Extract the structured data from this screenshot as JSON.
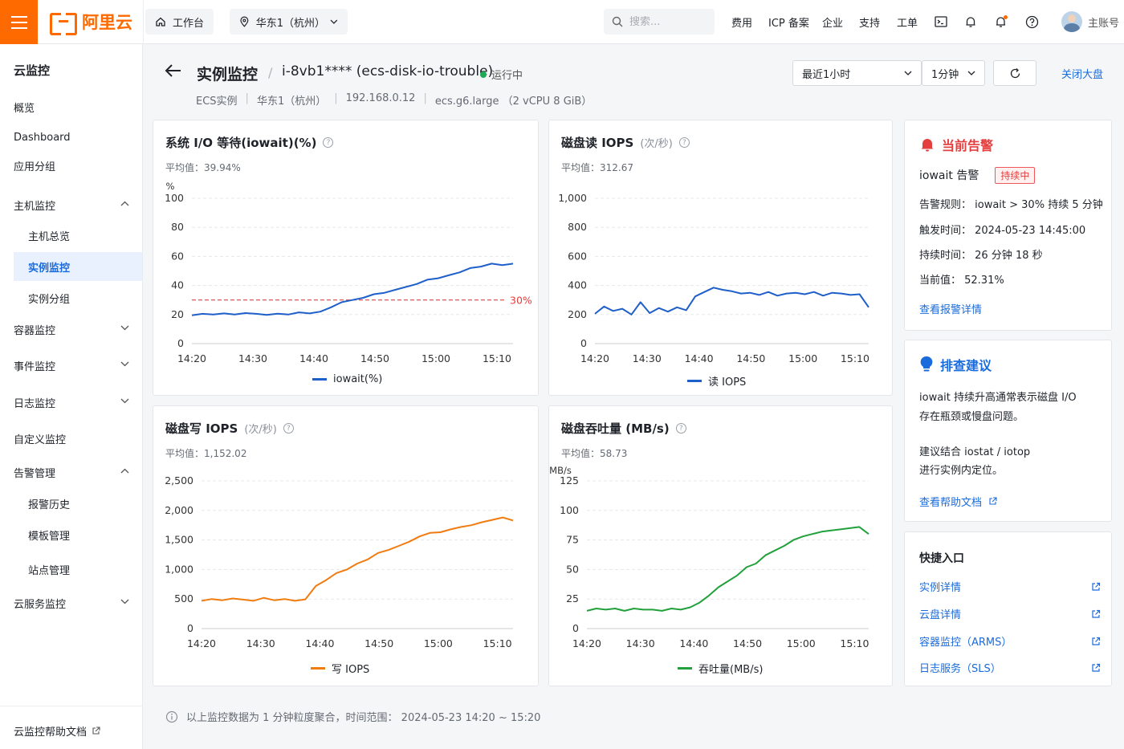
{
  "topbar": {
    "brand": "阿里云",
    "workbench": "工作台",
    "region": "华东1（杭州）",
    "search_placeholder": "搜索...",
    "nav": [
      "费用",
      "ICP 备案",
      "企业",
      "支持",
      "工单"
    ],
    "account": "主账号"
  },
  "sidebar": {
    "title": "云监控",
    "items": [
      {
        "label": "概览",
        "level": 0
      },
      {
        "label": "Dashboard",
        "level": 0
      },
      {
        "label": "应用分组",
        "level": 0
      },
      {
        "label": "主机监控",
        "level": 0,
        "expanded": true
      },
      {
        "label": "主机总览",
        "level": 1
      },
      {
        "label": "实例监控",
        "level": 1,
        "active": true
      },
      {
        "label": "实例分组",
        "level": 1
      },
      {
        "label": "容器监控",
        "level": 0,
        "expanded": false
      },
      {
        "label": "事件监控",
        "level": 0,
        "expanded": false
      },
      {
        "label": "日志监控",
        "level": 0,
        "expanded": false
      },
      {
        "label": "自定义监控",
        "level": 0
      },
      {
        "label": "告警管理",
        "level": 0,
        "expanded": true
      },
      {
        "label": "报警历史",
        "level": 1
      },
      {
        "label": "模板管理",
        "level": 1
      },
      {
        "label": "站点管理",
        "level": 1
      },
      {
        "label": "云服务监控",
        "level": 0,
        "expanded": false
      }
    ],
    "footer_link": "云监控帮助文档"
  },
  "header": {
    "title": "实例监控",
    "instance": "i-8vb1**** (ecs-disk-io-trouble)",
    "status": "运行中",
    "meta": [
      "ECS实例",
      "华东1（杭州）",
      "192.168.0.12",
      "ecs.g6.large （2 vCPU 8 GiB）"
    ],
    "time_range": "最近1小时",
    "interval": "1分钟",
    "close_dashboard": "关闭大盘"
  },
  "charts": {
    "iowait": {
      "title": "系统 I/O 等待(iowait)(%)",
      "unit": "",
      "avg_label": "平均值：",
      "avg_value": "39.94%",
      "legend": "iowait(%)",
      "threshold_label": "30%"
    },
    "read_iops": {
      "title": "磁盘读  IOPS",
      "unit": "(次/秒)",
      "avg_label": "平均值：",
      "avg_value": "312.67",
      "legend": "读 IOPS"
    },
    "write_iops": {
      "title": "磁盘写  IOPS",
      "unit": "(次/秒)",
      "avg_label": "平均值：",
      "avg_value": "1,152.02",
      "legend": "写 IOPS"
    },
    "throughput": {
      "title": "磁盘吞吐量 (MB/s)",
      "unit": "",
      "avg_label": "平均值：",
      "avg_value": "58.73",
      "legend": "吞吐量(MB/s)"
    }
  },
  "chart_data": [
    {
      "type": "line",
      "title": "系统 I/O 等待(iowait)(%)",
      "ylabel": "%",
      "ylim": [
        0,
        100
      ],
      "yticks": [
        0,
        20,
        40,
        60,
        80,
        100
      ],
      "xticks": [
        "14:20",
        "14:30",
        "14:40",
        "14:50",
        "15:00",
        "15:10"
      ],
      "threshold": 30,
      "color": "#1f5fc9",
      "series": [
        {
          "name": "iowait(%)",
          "x": [
            0,
            2,
            4,
            6,
            8,
            10,
            12,
            14,
            16,
            18,
            20,
            22,
            24,
            26,
            28,
            30,
            32,
            34,
            36,
            38,
            40,
            42,
            44,
            46,
            48,
            50,
            52,
            54,
            56,
            58,
            60
          ],
          "values": [
            19.5,
            20.5,
            20,
            20.8,
            20,
            21,
            20.5,
            19.8,
            20.6,
            20,
            21.5,
            20.8,
            22,
            25,
            28.5,
            30,
            31.5,
            34,
            35,
            37,
            39,
            41,
            44,
            45,
            47,
            49,
            52,
            53,
            55,
            54,
            55
          ]
        }
      ]
    },
    {
      "type": "line",
      "title": "磁盘读  IOPS",
      "ylim": [
        0,
        1000
      ],
      "yticks": [
        "0",
        "200",
        "400",
        "600",
        "800",
        "1,000"
      ],
      "xticks": [
        "14:20",
        "14:30",
        "14:40",
        "14:50",
        "15:00",
        "15:10"
      ],
      "color": "#1f5fc9",
      "series": [
        {
          "name": "读 IOPS",
          "x": [
            0,
            2,
            4,
            6,
            8,
            10,
            12,
            14,
            16,
            18,
            20,
            22,
            24,
            26,
            28,
            30,
            32,
            34,
            36,
            38,
            40,
            42,
            44,
            46,
            48,
            50,
            52,
            54,
            56,
            58,
            60
          ],
          "values": [
            205,
            255,
            225,
            240,
            200,
            285,
            210,
            245,
            220,
            250,
            230,
            325,
            355,
            385,
            370,
            360,
            345,
            350,
            335,
            355,
            330,
            345,
            350,
            340,
            355,
            330,
            350,
            345,
            335,
            340,
            250
          ]
        }
      ]
    },
    {
      "type": "line",
      "title": "磁盘写  IOPS",
      "ylim": [
        0,
        2500
      ],
      "yticks": [
        "0",
        "500",
        "1,000",
        "1,500",
        "2,000",
        "2,500"
      ],
      "xticks": [
        "14:20",
        "14:30",
        "14:40",
        "14:50",
        "15:00",
        "15:10"
      ],
      "color": "#f07c10",
      "series": [
        {
          "name": "写 IOPS",
          "x": [
            0,
            2,
            4,
            6,
            8,
            10,
            12,
            14,
            16,
            18,
            20,
            22,
            24,
            26,
            28,
            30,
            32,
            34,
            36,
            38,
            40,
            42,
            44,
            46,
            48,
            50,
            52,
            54,
            56,
            58,
            60
          ],
          "values": [
            470,
            500,
            480,
            510,
            490,
            470,
            520,
            480,
            500,
            470,
            495,
            720,
            820,
            940,
            1000,
            1100,
            1170,
            1280,
            1330,
            1400,
            1470,
            1560,
            1620,
            1630,
            1680,
            1720,
            1750,
            1800,
            1840,
            1880,
            1830
          ]
        }
      ]
    },
    {
      "type": "line",
      "title": "磁盘吞吐量 (MB/s)",
      "ylabel": "MB/s",
      "ylim": [
        0,
        125
      ],
      "yticks": [
        0,
        25,
        50,
        75,
        100,
        125
      ],
      "xticks": [
        "14:20",
        "14:30",
        "14:40",
        "14:50",
        "15:00",
        "15:10"
      ],
      "color": "#22a03c",
      "series": [
        {
          "name": "吞吐量(MB/s)",
          "x": [
            0,
            2,
            4,
            6,
            8,
            10,
            12,
            14,
            16,
            18,
            20,
            22,
            24,
            26,
            28,
            30,
            32,
            34,
            36,
            38,
            40,
            42,
            44,
            46,
            48,
            50,
            52,
            54,
            56,
            58,
            60
          ],
          "values": [
            15,
            17,
            16,
            17,
            15,
            17,
            16,
            16,
            15,
            17,
            16,
            18,
            22,
            28,
            35,
            40,
            45,
            52,
            55,
            62,
            66,
            70,
            75,
            78,
            80,
            82,
            83,
            84,
            85,
            86,
            80
          ]
        }
      ]
    }
  ],
  "alert": {
    "title": "当前告警",
    "name": "iowait 告警",
    "badge": "持续中",
    "rule": "告警规则：  iowait > 30% 持续 5 分钟",
    "trigger_time": "触发时间：  2024-05-23 14:45:00",
    "duration": "持续时间：  26 分钟 18 秒",
    "current": "当前值：  52.31%",
    "link": "查看报警详情"
  },
  "advice": {
    "title": "排查建议",
    "line1": "iowait 持续升高通常表示磁盘 I/O",
    "line2": "存在瓶颈或慢盘问题。",
    "line3": "建议结合 iostat / iotop",
    "line4": "进行实例内定位。",
    "link": "查看帮助文档"
  },
  "quick": {
    "title": "快捷入口",
    "links": [
      "实例详情",
      "云盘详情",
      "容器监控（ARMS）",
      "日志服务（SLS）"
    ]
  },
  "footnote": "以上监控数据为 1 分钟粒度聚合，时间范围：  2024-05-23  14:20  ~  15:20",
  "colors": {
    "accent": "#ff6a00",
    "link": "#1a6bdc",
    "alert": "#e53e3e",
    "iowait": "#1f5fc9",
    "write": "#f07c10",
    "throughput": "#22a03c"
  }
}
